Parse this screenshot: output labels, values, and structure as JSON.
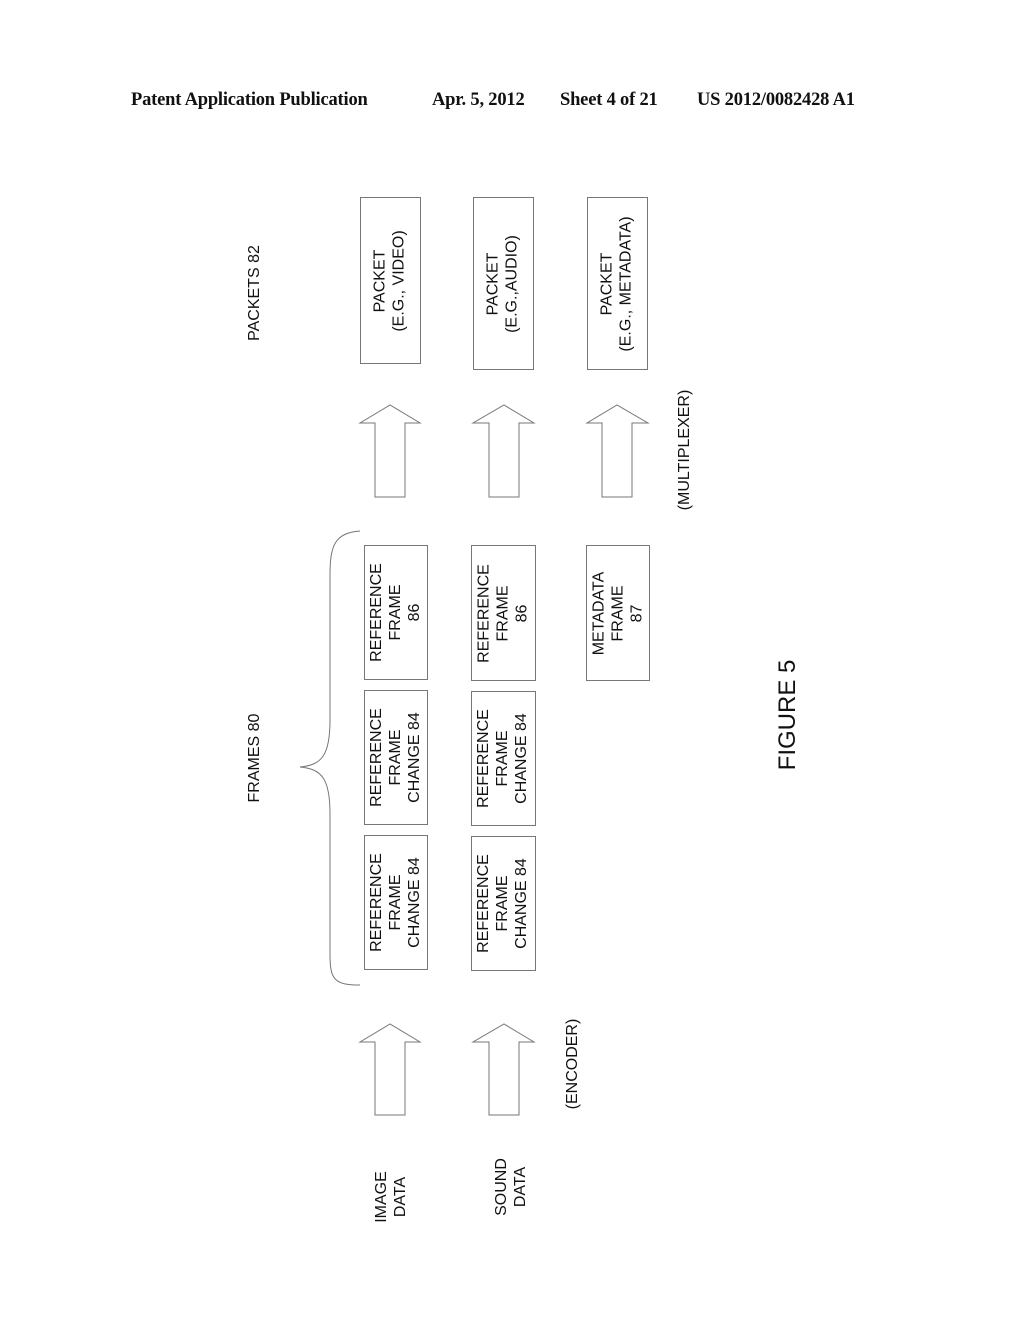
{
  "header": {
    "publication": "Patent Application Publication",
    "date": "Apr. 5, 2012",
    "sheet": "Sheet 4 of 21",
    "number": "US 2012/0082428 A1"
  },
  "figure": {
    "title": "FIGURE 5",
    "packets_label": "PACKETS 82",
    "frames_label": "FRAMES 80",
    "multiplexer_label": "(MULTIPLEXER)",
    "encoder_label": "(ENCODER)",
    "packets": [
      "PACKET\n(E.G., VIDEO)",
      "PACKET\n(E.G.,AUDIO)",
      "PACKET\n(E.G., METADATA)"
    ],
    "frames": {
      "image_row": [
        "REFERENCE\nFRAME\n86",
        "REFERENCE\nFRAME\nCHANGE 84",
        "REFERENCE\nFRAME\nCHANGE 84"
      ],
      "sound_row": [
        "REFERENCE\nFRAME\n86",
        "REFERENCE\nFRAME\nCHANGE 84",
        "REFERENCE\nFRAME\nCHANGE 84"
      ],
      "metadata_row": [
        "METADATA\nFRAME\n87"
      ]
    },
    "inputs": [
      "IMAGE\nDATA",
      "SOUND\nDATA"
    ]
  }
}
